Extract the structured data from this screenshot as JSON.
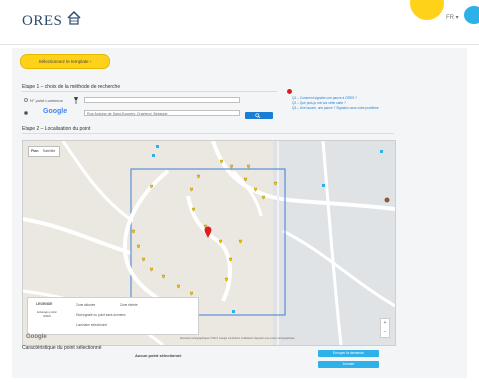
{
  "header": {
    "logo_text": "ORES",
    "language": "FR ▾",
    "accent_color": "#ffd21a",
    "brand_blue": "#2eb0e8"
  },
  "template_button": {
    "label": "Sélectionnez le template ›"
  },
  "step1": {
    "title": "Etape 1 – choix de la méthode de recherche",
    "option_number_label": "N° point Lumineux",
    "option_google_label": "Google",
    "google_query": "Rue Antoine de Saint-Exupéry, Charleroi, Belgique",
    "search_icon": "search-icon"
  },
  "help": {
    "lines": [
      "Q1 – Comment signaler une panne à ORES ?",
      "Q2 – Que puis-je voir sur cette carte ?",
      "Q3 – Une lacune, une panne ? Signalez-nous votre problème"
    ]
  },
  "step2": {
    "title": "Etape 2 – Localisation du point",
    "map_tabs": [
      "Plan",
      "Satellite"
    ],
    "legend_title": "LEGENDE",
    "legend_logo": "Eclairage public ORES",
    "legend_items": [
      "Zone allumée",
      "Zone éteinte",
      "Etat signalé ou point sans données",
      "Luminaire sélectionné"
    ],
    "google": "Google",
    "attribution": "Données cartographiques ©2017 Google   Conditions d'utilisation   Signaler une erreur cartographique",
    "zoom_in": "+",
    "zoom_out": "−"
  },
  "step3": {
    "title": "Caractéristique du point sélectionné",
    "none_selected": "Aucun point sélectionné",
    "buttons": [
      "Envoyer la demande",
      "Annuler"
    ]
  }
}
